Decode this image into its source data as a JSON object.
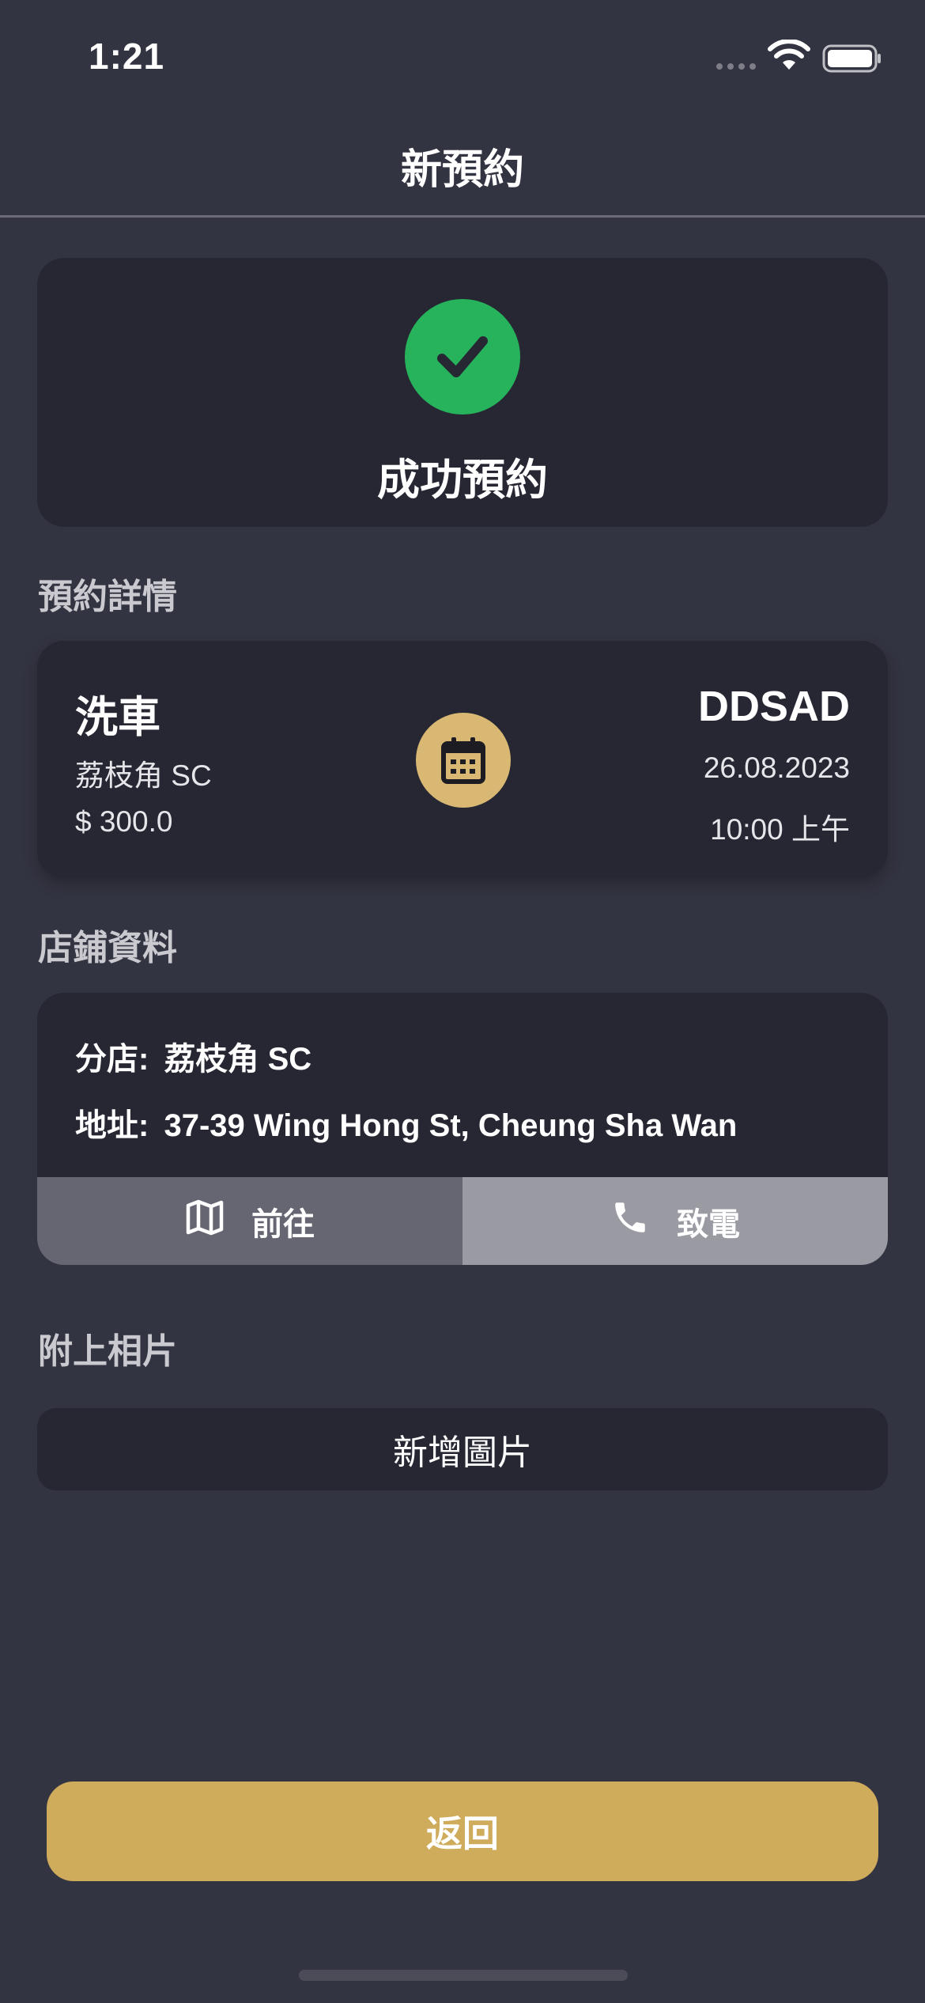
{
  "status_bar": {
    "time": "1:21"
  },
  "nav": {
    "title": "新預約"
  },
  "success": {
    "text": "成功預約",
    "icon": "check-icon",
    "color": "#26b35c"
  },
  "booking_details": {
    "section_title": "預約詳情",
    "service": "洗車",
    "branch": "荔枝角 SC",
    "price": "$ 300.0",
    "plate": "DDSAD",
    "date": "26.08.2023",
    "time": "10:00 上午",
    "icon": "calendar-icon"
  },
  "store_info": {
    "section_title": "店鋪資料",
    "branch_label": "分店:",
    "branch_value": "荔枝角 SC",
    "address_label": "地址:",
    "address_value": "37-39 Wing Hong St, Cheung Sha Wan",
    "go_button": "前往",
    "call_button": "致電"
  },
  "photos": {
    "section_title": "附上相片",
    "add_button": "新增圖片"
  },
  "footer": {
    "back_button": "返回",
    "accent_color": "#cfab5c"
  }
}
